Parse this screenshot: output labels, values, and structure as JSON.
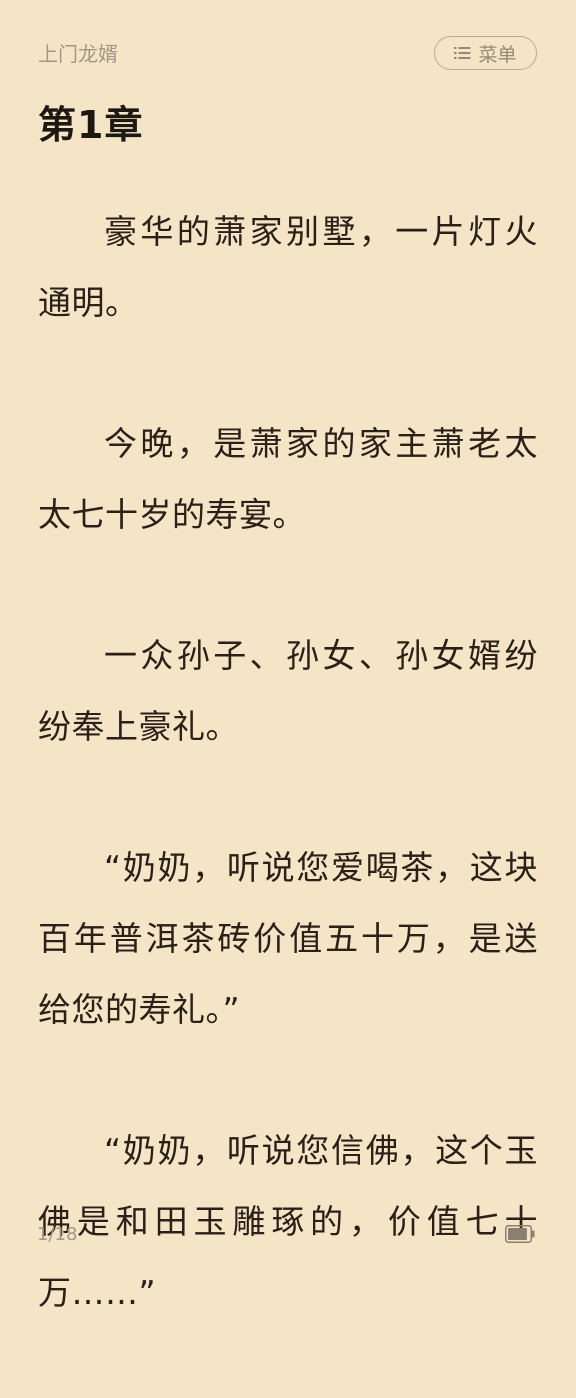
{
  "header": {
    "book_title": "上门龙婿",
    "menu_label": "菜单"
  },
  "chapter": {
    "title": "第1章",
    "paragraphs": [
      "豪华的萧家别墅，一片灯火通明。",
      "今晚，是萧家的家主萧老太太七十岁的寿宴。",
      "一众孙子、孙女、孙女婿纷纷奉上豪礼。",
      "“奶奶，听说您爱喝茶，这块百年普洱茶砖价值五十万，是送给您的寿礼。”",
      "“奶奶，听说您信佛，这个玉佛是和田玉雕琢的，价值七十万……”"
    ]
  },
  "footer": {
    "page_indicator": "1/18",
    "battery_level": 0.9
  },
  "icons": {
    "menu": "list-icon",
    "battery": "battery-icon"
  },
  "colors": {
    "background": "#f5e5c7",
    "text": "#2a2018",
    "muted": "#a29785"
  }
}
